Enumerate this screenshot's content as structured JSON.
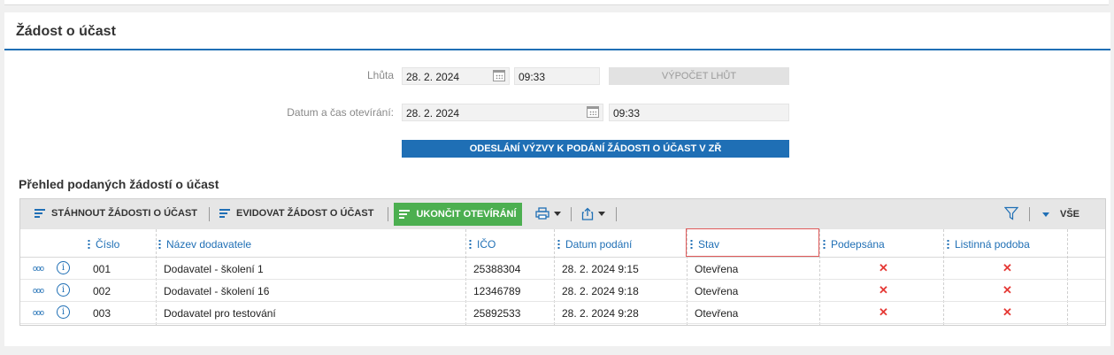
{
  "panel": {
    "title": "Žádost o účast"
  },
  "form": {
    "deadline": {
      "label": "Lhůta",
      "date": "28. 2. 2024",
      "time": "09:33"
    },
    "calc_button": "VÝPOČET LHŮT",
    "opening": {
      "label": "Datum a čas otevírání:",
      "date": "28. 2. 2024",
      "time": "09:33"
    },
    "send_button": "ODESLÁNÍ VÝZVY K PODÁNÍ ŽÁDOSTI O ÚČAST V ZŘ"
  },
  "overview": {
    "title": "Přehled podaných žádostí o účast",
    "toolbar": {
      "download": "STÁHNOUT ŽÁDOSTI O ÚČAST",
      "register": "EVIDOVAT ŽÁDOST O ÚČAST",
      "finish": "UKONČIT OTEVÍRÁNÍ",
      "all": "VŠE",
      "icons": [
        "print-icon",
        "export-icon",
        "filter-icon"
      ]
    },
    "columns": [
      "Číslo",
      "Název dodavatele",
      "IČO",
      "Datum podání",
      "Stav",
      "Podepsána",
      "Listinná podoba"
    ],
    "rows": [
      {
        "number": "001",
        "supplier": "Dodavatel - školení 1",
        "ico": "25388304",
        "submitted": "28. 2. 2024 9:15",
        "status": "Otevřena",
        "signed": "✕",
        "paper": "✕"
      },
      {
        "number": "002",
        "supplier": "Dodavatel - školení 16",
        "ico": "12346789",
        "submitted": "28. 2. 2024 9:18",
        "status": "Otevřena",
        "signed": "✕",
        "paper": "✕"
      },
      {
        "number": "003",
        "supplier": "Dodavatel pro testování",
        "ico": "25892533",
        "submitted": "28. 2. 2024 9:28",
        "status": "Otevřena",
        "signed": "✕",
        "paper": "✕"
      }
    ],
    "row_actions": {
      "more": "ooo",
      "info": "i"
    }
  },
  "colors": {
    "accent": "#1f6fb5",
    "success": "#4caf50",
    "danger": "#e53935",
    "highlight_border": "#e05a5a"
  }
}
